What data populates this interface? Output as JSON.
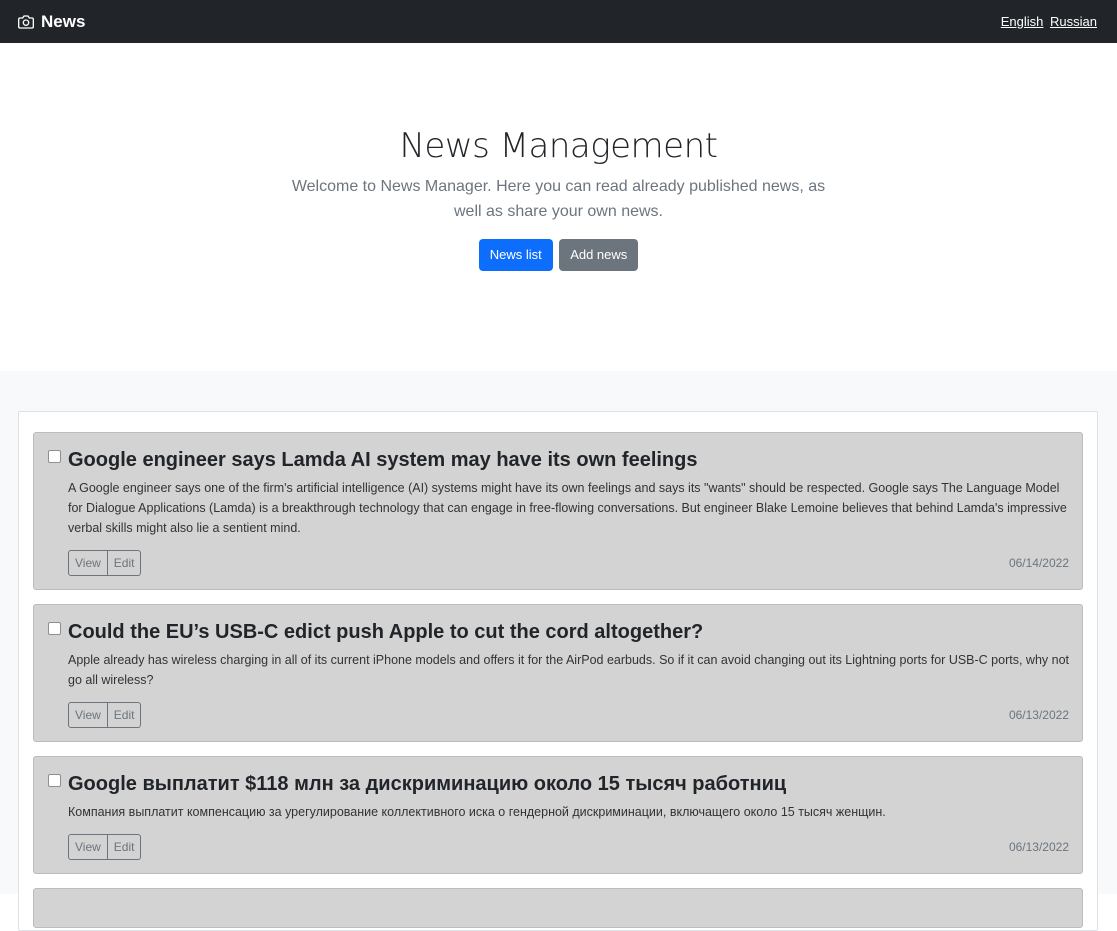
{
  "navbar": {
    "brand": "News",
    "languages": [
      "English",
      "Russian"
    ]
  },
  "hero": {
    "title": "News Management",
    "lead": "Welcome to News Manager. Here you can read already published news, as well as share your own news.",
    "primary_button": "News list",
    "secondary_button": "Add news"
  },
  "news": [
    {
      "title": "Google engineer says Lamda AI system may have its own feelings",
      "text": "A Google engineer says one of the firm's artificial intelligence (AI) systems might have its own feelings and says its \"wants\" should be respected. Google says The Language Model for Dialogue Applications (Lamda) is a breakthrough technology that can engage in free-flowing conversations. But engineer Blake Lemoine believes that behind Lamda's impressive verbal skills might also lie a sentient mind.",
      "view_label": "View",
      "edit_label": "Edit",
      "date": "06/14/2022"
    },
    {
      "title": "Could the EU’s USB-C edict push Apple to cut the cord altogether?",
      "text": "Apple already has wireless charging in all of its current iPhone models and offers it for the AirPod earbuds. So if it can avoid changing out its Lightning ports for USB-C ports, why not go all wireless?",
      "view_label": "View",
      "edit_label": "Edit",
      "date": "06/13/2022"
    },
    {
      "title": "Google выплатит $118 млн за дискриминацию около 15 тысяч работниц",
      "text": "Компания выплатит компенсацию за урегулирование коллективного иска о гендерной дискриминации, включащего около 15 тысяч женщин.",
      "view_label": "View",
      "edit_label": "Edit",
      "date": "06/13/2022"
    }
  ],
  "icons": {
    "brand": "camera-icon"
  },
  "colors": {
    "navbar": "#212529",
    "primary": "#0d6efd",
    "secondary": "#6c757d",
    "card": "#d3d3d3"
  }
}
